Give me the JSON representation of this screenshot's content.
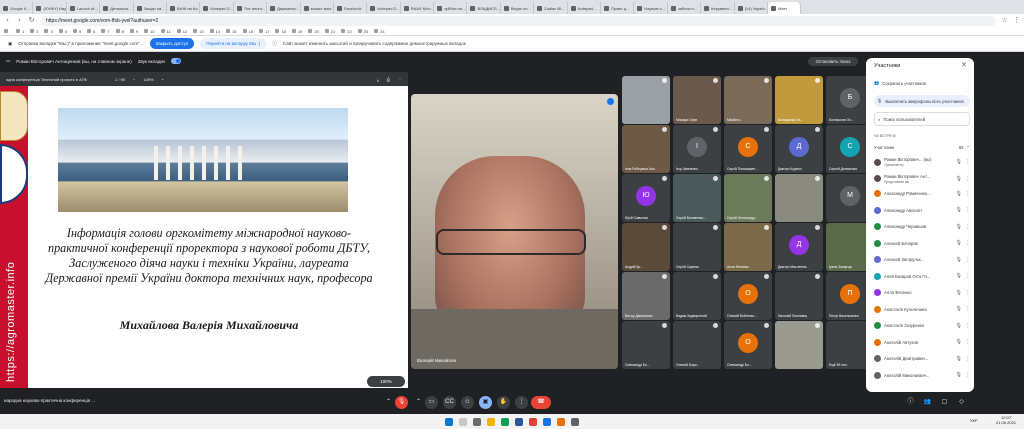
{
  "browser": {
    "tabs": [
      "Google K...",
      "(ЮНКУ) Нау...",
      "Launch of...",
      "Детальна...",
      "Засіди на...",
      "ВНЖ на Ко...",
      "Notepad G...",
      "The neuro...",
      "Держаvна...",
      "захист мал...",
      "Facebook",
      "Notepad D...",
      "RAAS Мол...",
      "зуббез на ...",
      "ВЛАДИСЛ...",
      "Вхідні ли...",
      "Zodiac Bl...",
      "Notepad...",
      "Право ц...",
      "Наукові с...",
      "заботи:н...",
      "Керуванн...",
      "(14) Україн...",
      "Meet"
    ],
    "url": "https://meet.google.com/vom-ffsb-yvel?authuser=2",
    "bookmarks": [
      "",
      "1",
      "2",
      "3",
      "4",
      "5",
      "6",
      "7",
      "8",
      "9",
      "10",
      "11",
      "12",
      "13",
      "14",
      "15",
      "16",
      "17",
      "18",
      "19",
      "20",
      "21",
      "22",
      "23",
      "24"
    ]
  },
  "sharebar": {
    "text": "Отправка вкладки \"Мы:)\" в приложение \"meet.google.com\"...",
    "stop": "Закрыть доступ",
    "switch": "Перейти на вкладку Мы :)",
    "note": "Сайт может изменить масштаб и прокручивать содержимое демонстрируемых вкладок"
  },
  "meet": {
    "presenter": "Роман Вікторович Антощенков (вы, на главном экране)",
    "audio": "Звук вкладки",
    "stop_present": "Остановить показ",
    "meeting_title": "народна науково-практична конференція ...",
    "main_speaker": "Валерій Михайлов"
  },
  "pdf": {
    "title": "одна конференція Технічний прогрес в АПК",
    "page": "1 / 90",
    "zoom": "149%",
    "body": "Інформація голови оргкомітету міжнародної науково-практичної конференції проректора з наукової роботи ДБТУ, Заслуженого діяча науки і техніки України, лауреата Державної премії України доктора технічних наук, професора",
    "name": "Михайлова Валерія Михайловича",
    "watermark": "https://agromaster.info",
    "zoom_pill": "100%"
  },
  "tiles": [
    {
      "name": "",
      "av": "",
      "color": "#9aa0a6"
    },
    {
      "name": "Мажара Серв",
      "av": "",
      "color": "#6b5a4b"
    },
    {
      "name": "Міхайло...",
      "av": "",
      "color": "#7a6a5a"
    },
    {
      "name": "Володимир Ха...",
      "av": "",
      "color": "#c29a3e"
    },
    {
      "name": "Богомолов Ол...",
      "av": "Б",
      "color": "#5f6368"
    },
    {
      "name": "Володимир Ни...",
      "av": "",
      "color": "#8d6e63"
    },
    {
      "name": "Інна Роберівна Ано...",
      "av": "",
      "color": "#6d5a45"
    },
    {
      "name": "Ігор Шевченко",
      "av": "І",
      "color": "#5f6368"
    },
    {
      "name": "Сергій Пономарен...",
      "av": "С",
      "color": "#e8710a"
    },
    {
      "name": "Дмитро Куріпко",
      "av": "Д",
      "color": "#5b6ad0"
    },
    {
      "name": "Сергей Денисенко",
      "av": "С",
      "color": "#12a4af"
    },
    {
      "name": "",
      "av": "",
      "color": "#3c4043"
    },
    {
      "name": "Юрій Савченко",
      "av": "Ю",
      "color": "#9334e6"
    },
    {
      "name": "Сергій Воловенко...",
      "av": "",
      "color": "#4a5a5a"
    },
    {
      "name": "Сергій Олександр...",
      "av": "",
      "color": "#6a7a5a"
    },
    {
      "name": "",
      "av": "",
      "color": "#8a8a80"
    },
    {
      "name": "",
      "av": "М",
      "color": "#5f6368"
    },
    {
      "name": "",
      "av": "",
      "color": "#3c4043"
    },
    {
      "name": "Андрій Бр...",
      "av": "",
      "color": "#5a4a3a"
    },
    {
      "name": "Сергій Скрипко",
      "av": "",
      "color": "#3c4043"
    },
    {
      "name": "Алла Фесенко",
      "av": "",
      "color": "#7a6a4a"
    },
    {
      "name": "Дмитро Масленнік...",
      "av": "Д",
      "color": "#9334e6"
    },
    {
      "name": "Ірина Захарчук",
      "av": "",
      "color": "#5a6a4a"
    },
    {
      "name": "",
      "av": "",
      "color": "#3c4043"
    },
    {
      "name": "Віктор Дмитрієнко",
      "av": "",
      "color": "#6a6a6a"
    },
    {
      "name": "Вадим Задворотний",
      "av": "",
      "color": "#3c4043"
    },
    {
      "name": "Олексій Войтенко...",
      "av": "О",
      "color": "#e8710a"
    },
    {
      "name": "Николай Поплавец",
      "av": "",
      "color": "#3c4043"
    },
    {
      "name": "Петро Васильченко",
      "av": "П",
      "color": "#e8710a"
    },
    {
      "name": "",
      "av": "",
      "color": "#3c4043"
    },
    {
      "name": "Олександр Бо...",
      "av": "",
      "color": "#3c4043"
    },
    {
      "name": "Олексій Бори...",
      "av": "",
      "color": "#3c4043"
    },
    {
      "name": "Олександр Бо...",
      "av": "О",
      "color": "#e8710a"
    },
    {
      "name": "",
      "av": "",
      "color": "#9a9a90"
    },
    {
      "name": "Ещё 59 чел.",
      "av": "",
      "color": "#3c4043"
    },
    {
      "name": "Роман Вікт...",
      "av": "",
      "color": "#5a4a4a"
    }
  ],
  "panel": {
    "title": "Участники",
    "save": "Сохранить участников",
    "mute_all": "Выключить микрофоны всех участников",
    "search": "Поиск пользователей",
    "in_call": "НА ВСТРЕЧЕ",
    "group": "Участники",
    "count": "92",
    "people": [
      {
        "name": "Роман Вікторович... (вы)",
        "sub": "Организатор",
        "color": "#5a4a4a"
      },
      {
        "name": "Роман Вікторович Ант...",
        "sub": "Представлен вы",
        "color": "#5a4a4a"
      },
      {
        "name": "Александр Ромаченко...",
        "sub": "",
        "color": "#e8710a"
      },
      {
        "name": "Александр Авсеолт",
        "sub": "",
        "color": "#5b6ad0"
      },
      {
        "name": "Александр Чернишов",
        "sub": "",
        "color": "#1e8e3e"
      },
      {
        "name": "Алексей Бочаров",
        "sub": "",
        "color": "#1e8e3e"
      },
      {
        "name": "Алексей Загорульк...",
        "sub": "",
        "color": "#5b6ad0"
      },
      {
        "name": "Алия Базаров Отга Гя...",
        "sub": "",
        "color": "#12a4af"
      },
      {
        "name": "Алла Фесенко",
        "sub": "",
        "color": "#9334e6"
      },
      {
        "name": "Анастасія Кульчичина",
        "sub": "",
        "color": "#e37400"
      },
      {
        "name": "Анастасія Зозуренко",
        "sub": "",
        "color": "#1e8e3e"
      },
      {
        "name": "Анатолій Автухов",
        "sub": "",
        "color": "#e8710a"
      },
      {
        "name": "Анатолій Демітравин...",
        "sub": "",
        "color": "#5f6368"
      },
      {
        "name": "Анатолій Миколаєвич...",
        "sub": "",
        "color": "#5f6368"
      }
    ]
  },
  "taskbar": {
    "lang": "УКР",
    "time": "12:07",
    "date": "21.05.2021"
  }
}
